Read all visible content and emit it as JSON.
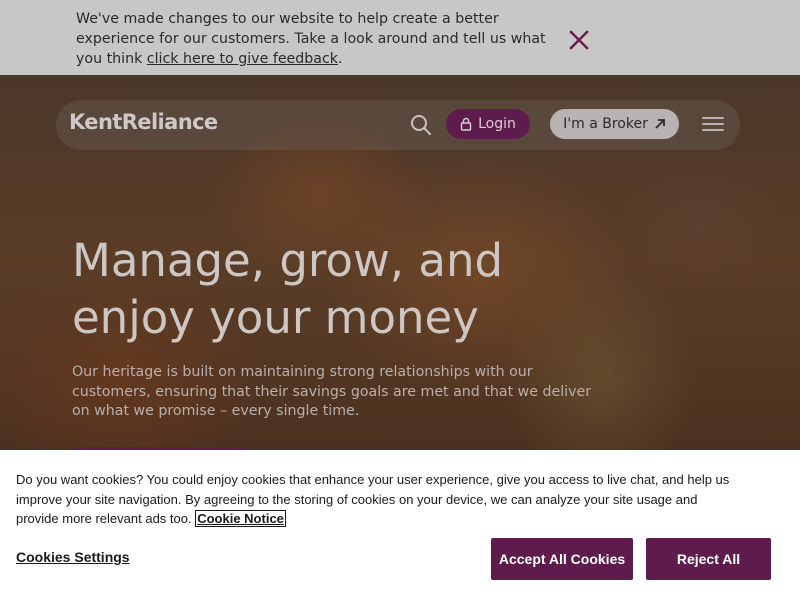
{
  "banner": {
    "text": "We've made changes to our website to help create a better experience for our customers. Take a look around and tell us what you think ",
    "link": "click here to give feedback",
    "suffix": ".",
    "close_icon": "close-icon",
    "close_color": "#6b1b4b"
  },
  "nav": {
    "logo": "KentReliance",
    "search_icon": "search-icon",
    "login_label": "Login",
    "login_icon": "lock-icon",
    "broker_label": "I'm a Broker",
    "broker_icon": "arrow-up-right-icon",
    "menu_icon": "hamburger-menu-icon"
  },
  "hero": {
    "title": "Manage, grow, and enjoy your money",
    "subtitle": "Our heritage is built on maintaining strong relationships with our customers, ensuring that their savings goals are met and that we deliver on what we promise – every single time."
  },
  "cookie": {
    "text": "Do you want cookies? You could enjoy cookies that enhance your user experience, give you access to live chat, and help us improve your site navigation. By agreeing to the storing of cookies on your device, we can analyze your site usage and provide more relevant ads too. ",
    "notice_link": "Cookie Notice",
    "settings_label": "Cookies Settings",
    "accept_label": "Accept All Cookies",
    "reject_label": "Reject All"
  },
  "colors": {
    "brand": "#5e1c4c",
    "banner_bg": "#c7c7c7",
    "cookie_bg": "#ffffff"
  }
}
